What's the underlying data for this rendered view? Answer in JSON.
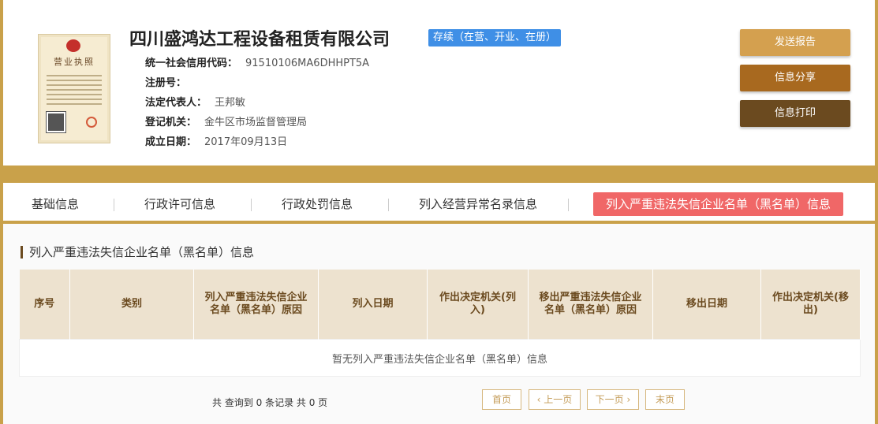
{
  "company": {
    "name": "四川盛鸿达工程设备租赁有限公司",
    "status": "存续（在营、开业、在册）",
    "license_title": "营业执照"
  },
  "info": [
    {
      "key": "统一社会信用代码：",
      "value": "91510106MA6DHHPT5A"
    },
    {
      "key": "注册号：",
      "value": ""
    },
    {
      "key": "法定代表人：",
      "value": "王邦敏"
    },
    {
      "key": "登记机关：",
      "value": "金牛区市场监督管理局"
    },
    {
      "key": "成立日期：",
      "value": "2017年09月13日"
    }
  ],
  "actions": {
    "send_report": "发送报告",
    "share": "信息分享",
    "print": "信息打印"
  },
  "tabs": [
    "基础信息",
    "行政许可信息",
    "行政处罚信息",
    "列入经营异常名录信息",
    "列入严重违法失信企业名单（黑名单）信息"
  ],
  "section": {
    "title": "列入严重违法失信企业名单（黑名单）信息",
    "columns": [
      "序号",
      "类别",
      "列入严重违法失信企业名单（黑名单）原因",
      "列入日期",
      "作出决定机关(列入)",
      "移出严重违法失信企业名单（黑名单）原因",
      "移出日期",
      "作出决定机关(移出)"
    ],
    "empty_text": "暂无列入严重违法失信企业名单（黑名单）信息"
  },
  "pager": {
    "summary": "共 查询到 0 条记录 共 0 页",
    "first": "首页",
    "prev": "上一页",
    "next": "下一页",
    "last": "末页"
  },
  "colors": {
    "gold": "#c9a14a",
    "status_blue": "#3f8fe6",
    "active_tab": "#f06767",
    "header_bg": "#ede2cf"
  }
}
